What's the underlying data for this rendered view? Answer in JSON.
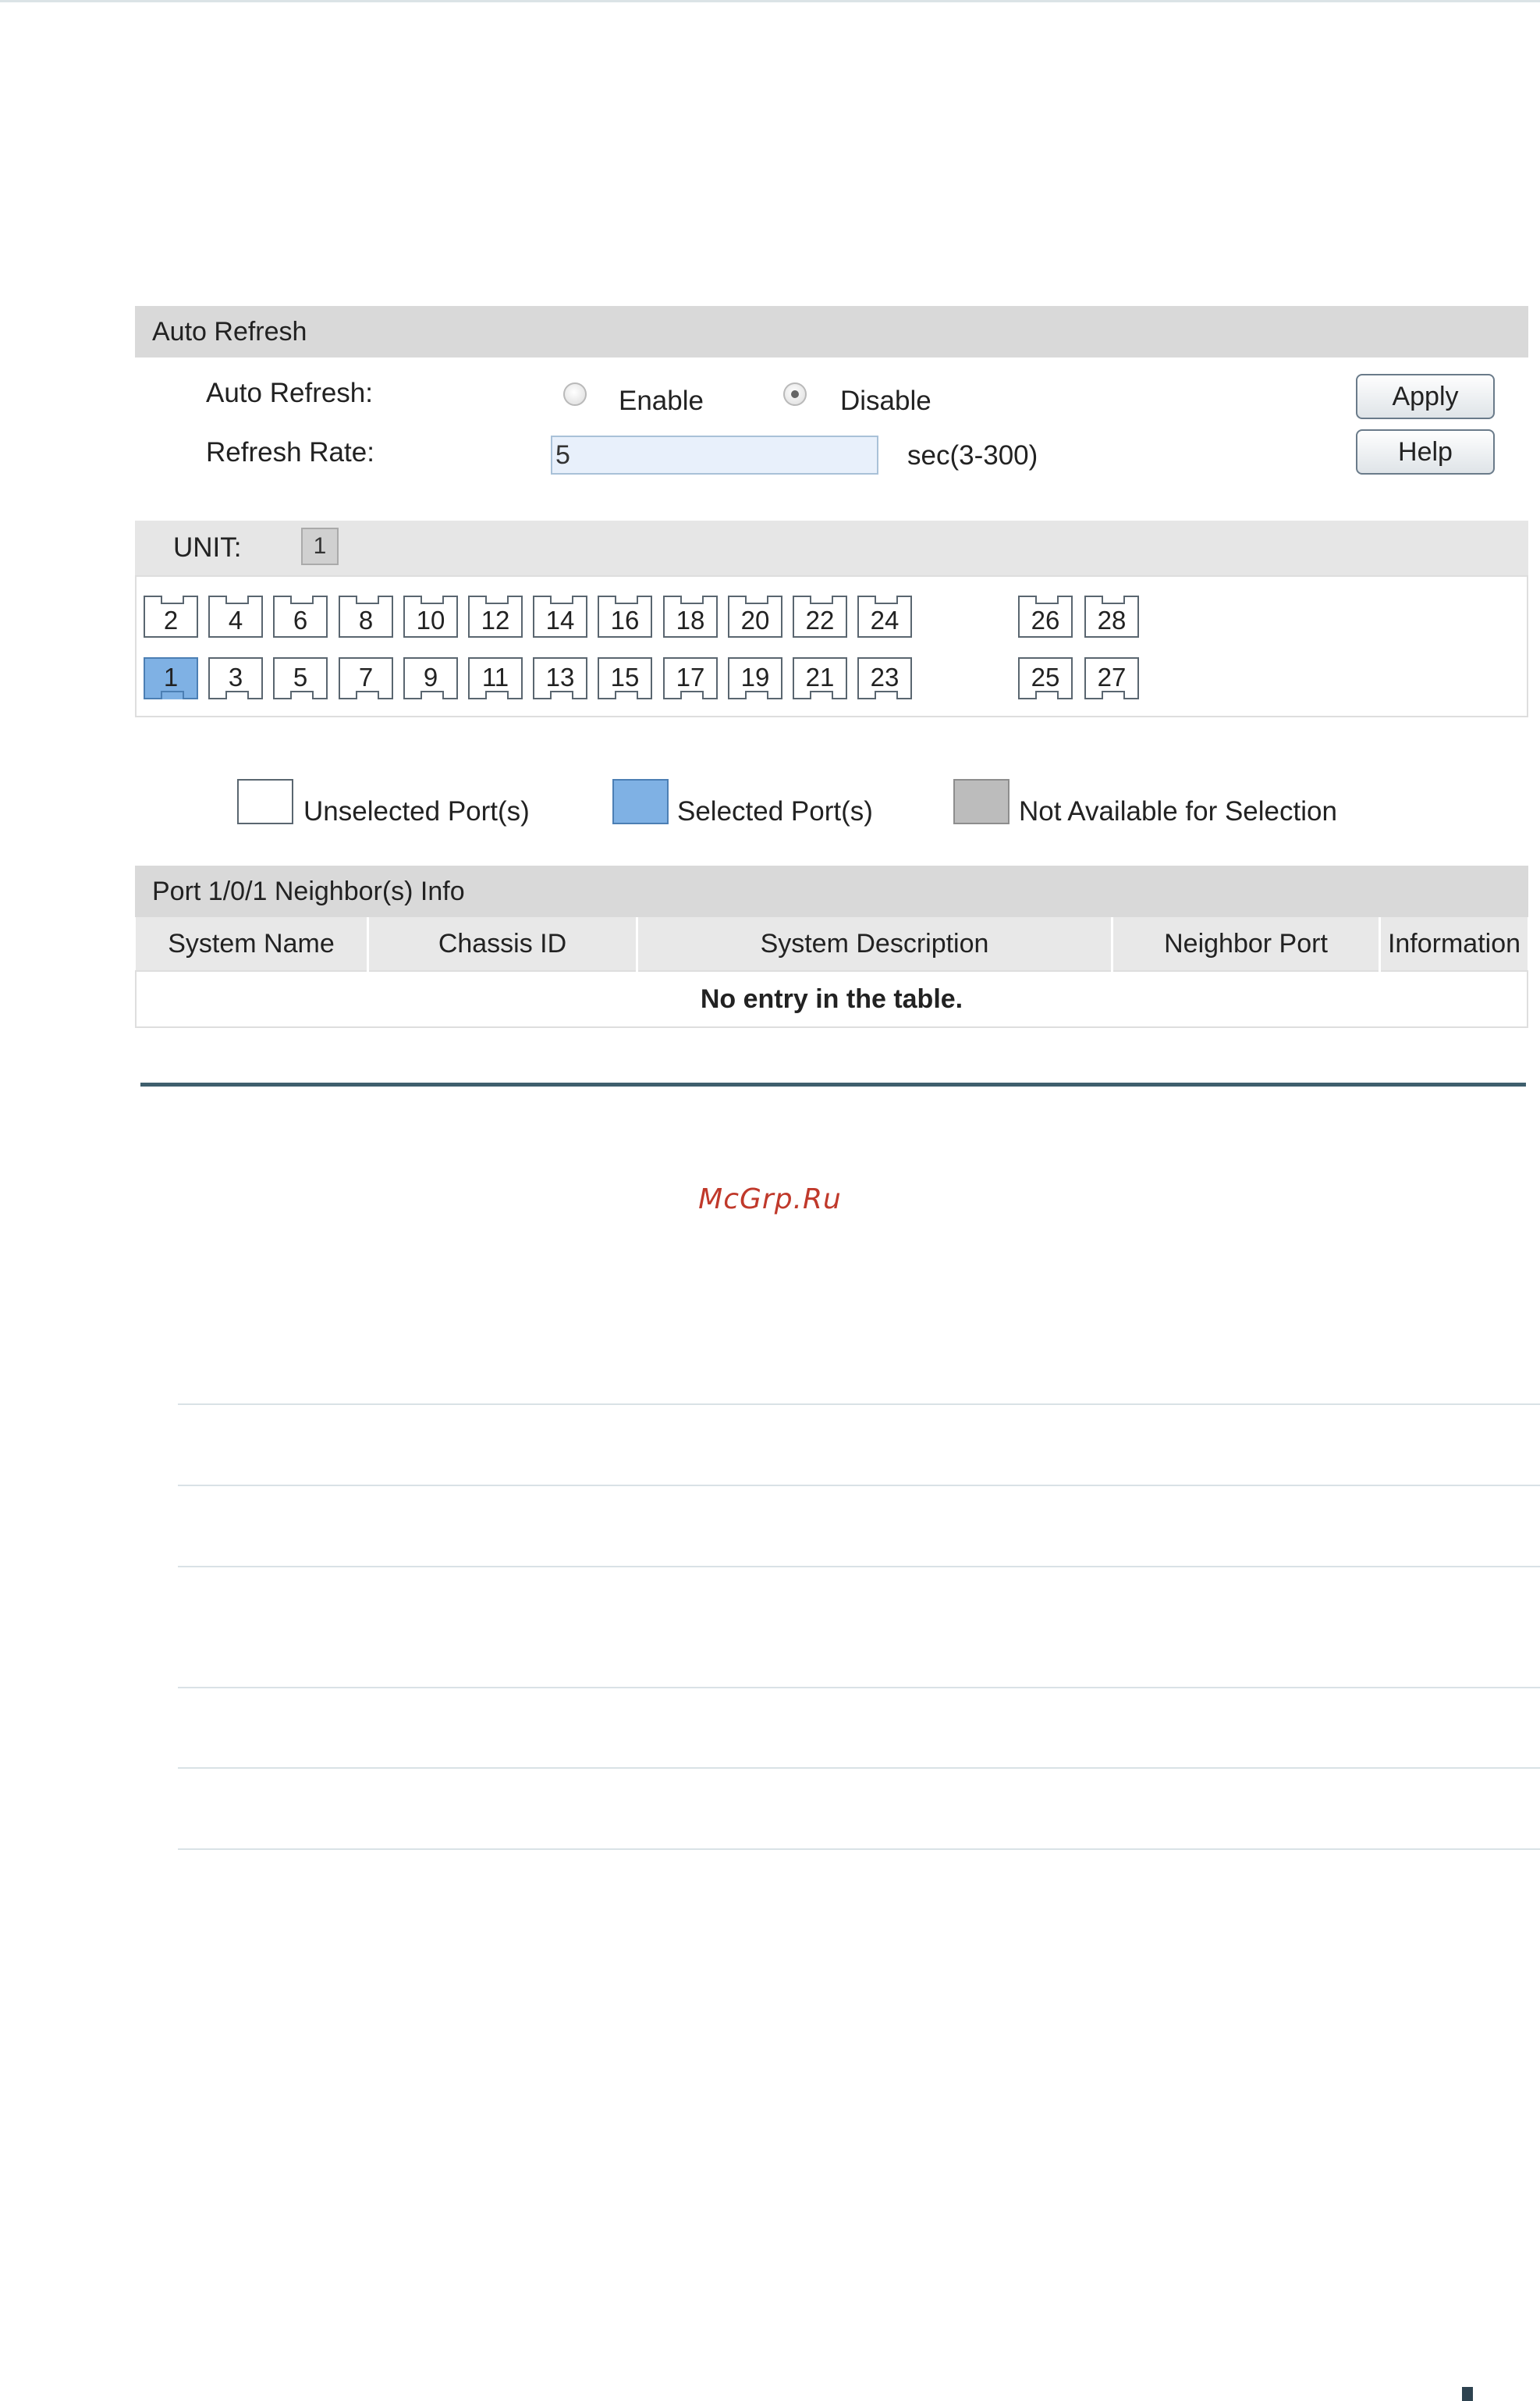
{
  "auto_refresh": {
    "header": "Auto Refresh",
    "auto_refresh_label": "Auto Refresh:",
    "enable_label": "Enable",
    "disable_label": "Disable",
    "selected": "Disable",
    "refresh_rate_label": "Refresh Rate:",
    "refresh_rate_value": "5",
    "refresh_rate_unit": "sec(3-300)",
    "apply_label": "Apply",
    "help_label": "Help"
  },
  "unit": {
    "label": "UNIT:",
    "value": "1"
  },
  "ports": {
    "top_row": [
      "2",
      "4",
      "6",
      "8",
      "10",
      "12",
      "14",
      "16",
      "18",
      "20",
      "22",
      "24"
    ],
    "top_row_extra": [
      "26",
      "28"
    ],
    "bottom_row": [
      "1",
      "3",
      "5",
      "7",
      "9",
      "11",
      "13",
      "15",
      "17",
      "19",
      "21",
      "23"
    ],
    "bottom_row_extra": [
      "25",
      "27"
    ],
    "selected": [
      "1"
    ]
  },
  "legend": {
    "unselected": "Unselected Port(s)",
    "selected": "Selected Port(s)",
    "not_available": "Not Available for Selection"
  },
  "neighbor": {
    "header": "Port 1/0/1 Neighbor(s) Info",
    "columns": [
      "System Name",
      "Chassis ID",
      "System Description",
      "Neighbor Port",
      "Information"
    ],
    "empty_message": "No entry in the table."
  },
  "watermark": "McGrp.Ru",
  "colors": {
    "header_bg": "#d9d9d9",
    "selected_port": "#7fb1e4",
    "unavailable_port": "#bcbcbc",
    "watermark": "#c0392b",
    "separator": "#3f5f6d"
  }
}
